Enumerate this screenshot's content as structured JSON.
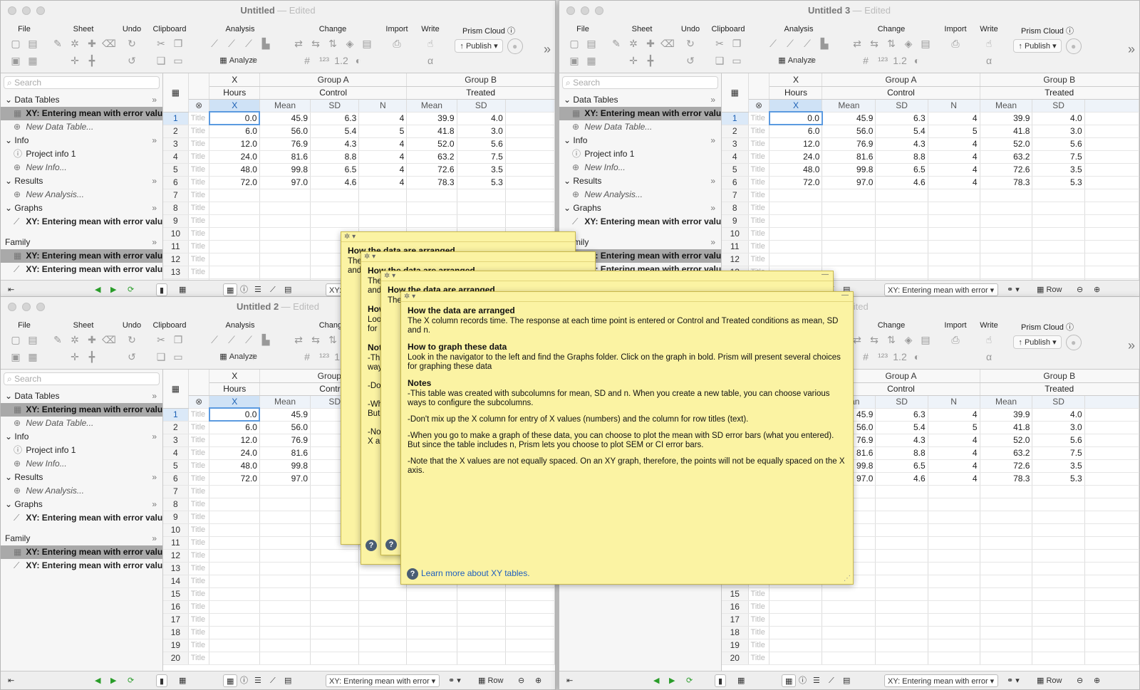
{
  "windows": {
    "w1": {
      "title": "Untitled",
      "edited": "Edited"
    },
    "w2": {
      "title": "Untitled 2",
      "edited": "Edited"
    },
    "w3": {
      "title": "Untitled 3",
      "edited": "Edited"
    },
    "w4": {
      "title": "",
      "edited": "Edited"
    }
  },
  "toolbar": {
    "file": "File",
    "sheet": "Sheet",
    "undo": "Undo",
    "clipboard": "Clipboard",
    "analysis": "Analysis",
    "analyze": "Analyze",
    "change": "Change",
    "import": "Import",
    "write": "Write",
    "cloud": "Prism Cloud",
    "publish": "Publish"
  },
  "nav": {
    "search_placeholder": "Search",
    "data_tables": "Data Tables",
    "table_item": "XY: Entering mean with error values",
    "new_table": "New Data Table...",
    "info": "Info",
    "project_info": "Project info 1",
    "new_info": "New Info...",
    "results": "Results",
    "new_analysis": "New Analysis...",
    "graphs": "Graphs",
    "graph_item": "XY: Entering mean with error values",
    "family": "Family",
    "family_item1": "XY: Entering mean with error values",
    "family_item2": "XY: Entering mean with error values"
  },
  "sheet": {
    "x_head": "X",
    "x_title": "Hours",
    "x_sub": "X",
    "group_a": "Group A",
    "group_a_title": "Control",
    "group_b": "Group B",
    "group_b_title": "Treated",
    "sub_mean": "Mean",
    "sub_sd": "SD",
    "sub_n": "N",
    "title_cell": "Title",
    "rows": [
      {
        "n": "1",
        "x": "0.0",
        "am": "45.9",
        "asd": "6.3",
        "an": "4",
        "bm": "39.9",
        "bsd": "4.0"
      },
      {
        "n": "2",
        "x": "6.0",
        "am": "56.0",
        "asd": "5.4",
        "an": "5",
        "bm": "41.8",
        "bsd": "3.0"
      },
      {
        "n": "3",
        "x": "12.0",
        "am": "76.9",
        "asd": "4.3",
        "an": "4",
        "bm": "52.0",
        "bsd": "5.6"
      },
      {
        "n": "4",
        "x": "24.0",
        "am": "81.6",
        "asd": "8.8",
        "an": "4",
        "bm": "63.2",
        "bsd": "7.5"
      },
      {
        "n": "5",
        "x": "48.0",
        "am": "99.8",
        "asd": "6.5",
        "an": "4",
        "bm": "72.6",
        "bsd": "3.5"
      },
      {
        "n": "6",
        "x": "72.0",
        "am": "97.0",
        "asd": "4.6",
        "an": "4",
        "bm": "78.3",
        "bsd": "5.3"
      }
    ]
  },
  "bottom": {
    "sheet_select": "XY: Entering mean with error",
    "row_label": "Row"
  },
  "note": {
    "h1": "How the data are arranged",
    "p1": "The X column records time. The response at each time point is entered or Control and Treated conditions as mean, SD and n.",
    "h2": "How to graph these data",
    "p2": "Look in the navigator to the left and find the Graphs folder. Click on the graph in bold. Prism will present several choices for graphing these data",
    "h3": "Notes",
    "p3": "-This table was created with subcolumns for mean, SD and n. When you create a new table, you can choose various ways to configure the subcolumns.",
    "p4": "-Don't mix up the X column for entry of X values (numbers) and the column for row titles (text).",
    "p5": "-When you go to make a graph of these data, you can choose to plot the mean with SD error bars (what you entered). But since the table includes n, Prism lets you choose to plot SEM or CI error bars.",
    "p6": "-Note that the X values are not equally spaced. On an XY graph, therefore, the points will not be equally spaced on the X axis.",
    "learn": "Learn more about XY tables.",
    "help_q": "?",
    "back_h1": "How the data are arranged",
    "back_t1": "The",
    "back_t2": "and",
    "back_h2": "How",
    "back_t3": "Look",
    "back_t4": "for",
    "back_h3": "Notes",
    "back_t5": "-This",
    "back_t6": "way",
    "back_t7": "-Do",
    "back_t8": "-Wh",
    "back_t9": "But",
    "back_t10": "-No",
    "back_t11": "X a"
  }
}
